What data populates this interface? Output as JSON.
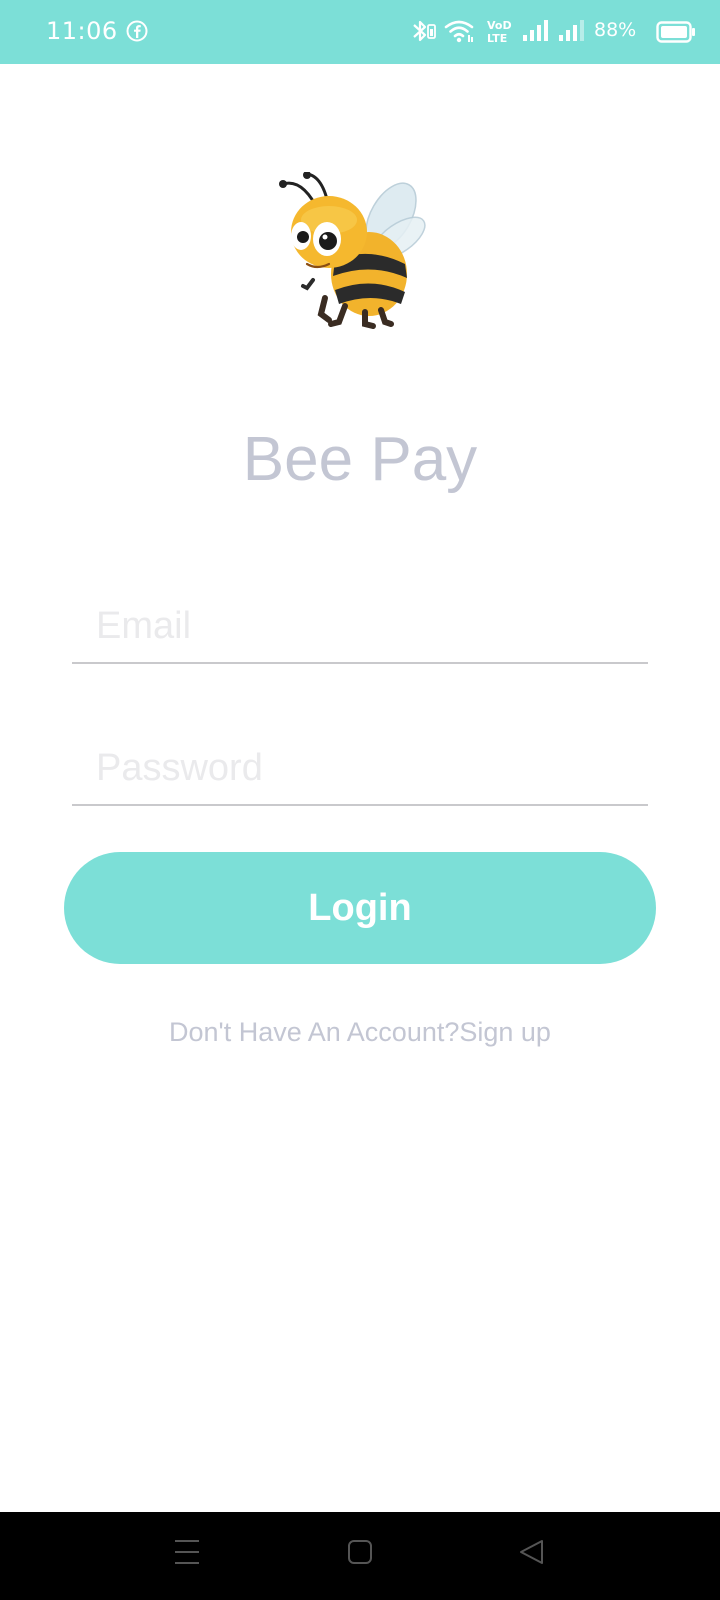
{
  "status_bar": {
    "time": "11:06",
    "battery": "88%",
    "background_color": "#7cdfd7",
    "icons": [
      "facebook-icon",
      "bluetooth-icon",
      "wifi-icon",
      "volte-icon",
      "signal-icon",
      "signal-icon",
      "battery-icon"
    ]
  },
  "app": {
    "logo_icon": "bee-logo",
    "title": "Bee Pay"
  },
  "form": {
    "email_placeholder": "Email",
    "email_value": "",
    "password_placeholder": "Password",
    "password_value": "",
    "login_label": "Login",
    "signup_prompt": "Don't Have An Account?",
    "signup_link": "Sign up"
  },
  "colors": {
    "accent": "#7cdfd7",
    "title_text": "#c3c6d3",
    "nav_bar": "#000000"
  },
  "nav_bar": {
    "icons": [
      "menu-icon",
      "home-icon",
      "back-icon"
    ]
  }
}
